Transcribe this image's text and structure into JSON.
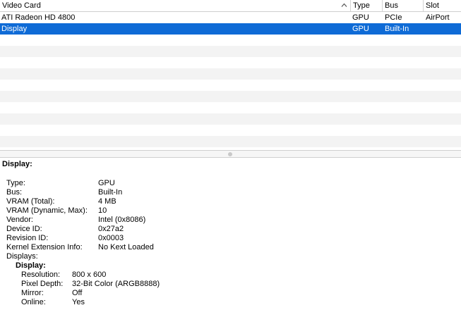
{
  "table": {
    "columns": [
      {
        "id": "name",
        "label": "Video Card"
      },
      {
        "id": "type",
        "label": "Type"
      },
      {
        "id": "bus",
        "label": "Bus"
      },
      {
        "id": "slot",
        "label": "Slot"
      }
    ],
    "sort_icon": "chevron-up-icon",
    "rows": [
      {
        "name": "ATI Radeon HD 4800",
        "type": "GPU",
        "bus": "PCIe",
        "slot": "AirPort",
        "selected": false
      },
      {
        "name": "Display",
        "type": "GPU",
        "bus": "Built-In",
        "slot": "",
        "selected": true
      }
    ]
  },
  "detail": {
    "title": "Display:",
    "fields": [
      {
        "key": "Type:",
        "value": "GPU"
      },
      {
        "key": "Bus:",
        "value": "Built-In"
      },
      {
        "key": "VRAM (Total):",
        "value": "4 MB"
      },
      {
        "key": "VRAM (Dynamic, Max):",
        "value": "10"
      },
      {
        "key": "Vendor:",
        "value": "Intel (0x8086)"
      },
      {
        "key": "Device ID:",
        "value": "0x27a2"
      },
      {
        "key": "Revision ID:",
        "value": "0x0003"
      },
      {
        "key": "Kernel Extension Info:",
        "value": "No Kext Loaded"
      }
    ],
    "displays_label": "Displays:",
    "display_name": "Display:",
    "display_fields": [
      {
        "key": "Resolution:",
        "value": "800 x 600"
      },
      {
        "key": "Pixel Depth:",
        "value": "32-Bit Color (ARGB8888)"
      },
      {
        "key": "Mirror:",
        "value": "Off"
      },
      {
        "key": "Online:",
        "value": "Yes"
      }
    ]
  },
  "colors": {
    "selection": "#0f6bd6",
    "alt_row": "#f3f3f3"
  }
}
